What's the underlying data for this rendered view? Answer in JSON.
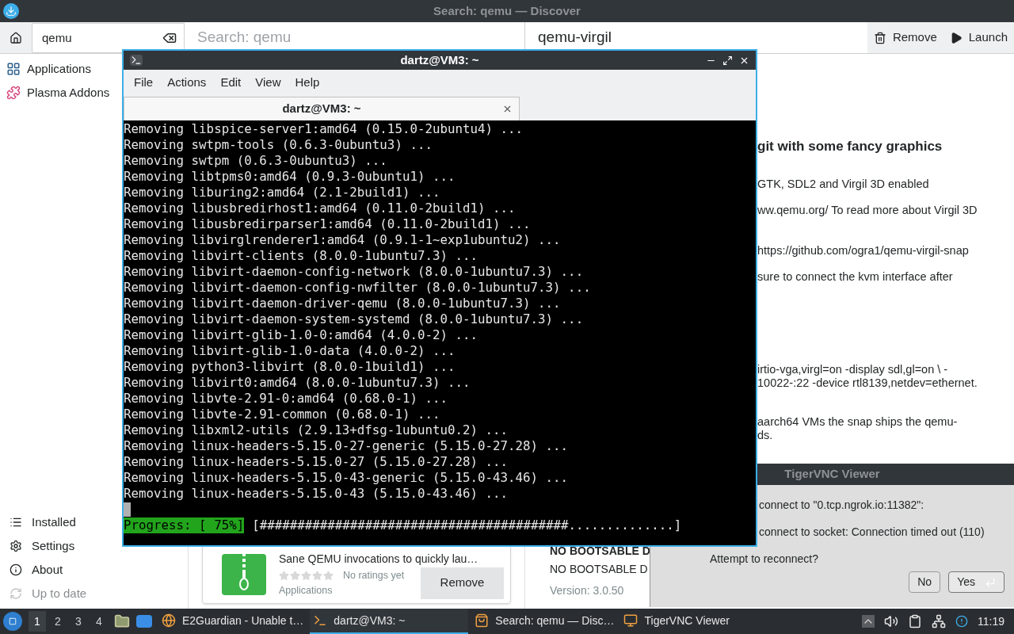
{
  "discover": {
    "title": "Search: qemu — Discover",
    "search": {
      "value": "qemu"
    },
    "list_header": "Search: qemu",
    "app_title": "qemu-virgil",
    "actions": [
      {
        "label": "Remove",
        "kind": "remove"
      },
      {
        "label": "Launch",
        "kind": "launch"
      }
    ],
    "categories": [
      {
        "label": "Applications",
        "kind": "applications"
      },
      {
        "label": "Plasma Addons",
        "kind": "addons"
      }
    ],
    "nav": [
      {
        "label": "Installed",
        "kind": "installed",
        "disabled": false
      },
      {
        "label": "Settings",
        "kind": "settings",
        "disabled": false
      },
      {
        "label": "About",
        "kind": "about",
        "disabled": false
      },
      {
        "label": "Up to date",
        "kind": "update",
        "disabled": true
      }
    ],
    "result_card": {
      "description": "Sane QEMU invocations to quickly lau…",
      "stars": 0,
      "rating_text": "No ratings yet",
      "category": "Applications",
      "button": "Remove"
    },
    "details": {
      "heading": "git with some fancy graphics",
      "paragraphs": [
        [
          "GTK, SDL2 and Virgil 3D enabled"
        ],
        [
          "ww.qemu.org/ To read more about Virgil 3D"
        ],
        [
          "https://github.com/ogra1/qemu-virgil-snap"
        ],
        [
          "sure to connect the kvm interface after"
        ],
        [
          "irtio-vga,virgl=on -display sdl,gl=on \\ -",
          "10022-:22 -device rtl8139,netdev=ethernet."
        ],
        [
          "aarch64 VMs the snap ships the qemu-",
          "ds."
        ]
      ]
    },
    "other_result": {
      "title": "NO BOOTSABLE D",
      "subtitle": "NO BOOTSABLE D",
      "version": "Version: 3.0.50"
    }
  },
  "terminal": {
    "title": "dartz@VM3: ~",
    "menu": [
      "File",
      "Actions",
      "Edit",
      "View",
      "Help"
    ],
    "tab": "dartz@VM3: ~",
    "lines": [
      "Removing libspice-server1:amd64 (0.15.0-2ubuntu4) ...",
      "Removing swtpm-tools (0.6.3-0ubuntu3) ...",
      "Removing swtpm (0.6.3-0ubuntu3) ...",
      "Removing libtpms0:amd64 (0.9.3-0ubuntu1) ...",
      "Removing liburing2:amd64 (2.1-2build1) ...",
      "Removing libusbredirhost1:amd64 (0.11.0-2build1) ...",
      "Removing libusbredirparser1:amd64 (0.11.0-2build1) ...",
      "Removing libvirglrenderer1:amd64 (0.9.1-1~exp1ubuntu2) ...",
      "Removing libvirt-clients (8.0.0-1ubuntu7.3) ...",
      "Removing libvirt-daemon-config-network (8.0.0-1ubuntu7.3) ...",
      "Removing libvirt-daemon-config-nwfilter (8.0.0-1ubuntu7.3) ...",
      "Removing libvirt-daemon-driver-qemu (8.0.0-1ubuntu7.3) ...",
      "Removing libvirt-daemon-system-systemd (8.0.0-1ubuntu7.3) ...",
      "Removing libvirt-glib-1.0-0:amd64 (4.0.0-2) ...",
      "Removing libvirt-glib-1.0-data (4.0.0-2) ...",
      "Removing python3-libvirt (8.0.0-1build1) ...",
      "Removing libvirt0:amd64 (8.0.0-1ubuntu7.3) ...",
      "Removing libvte-2.91-0:amd64 (0.68.0-1) ...",
      "Removing libvte-2.91-common (0.68.0-1) ...",
      "Removing libxml2-utils (2.9.13+dfsg-1ubuntu0.2) ...",
      "Removing linux-headers-5.15.0-27-generic (5.15.0-27.28) ...",
      "Removing linux-headers-5.15.0-27 (5.15.0-27.28) ...",
      "Removing linux-headers-5.15.0-43-generic (5.15.0-43.46) ...",
      "Removing linux-headers-5.15.0-43 (5.15.0-43.46) ..."
    ],
    "progress": {
      "label": "Progress: [ 75%]",
      "bar": "[#########################################..............]"
    }
  },
  "vnc_dialog": {
    "title": "TigerVNC Viewer",
    "lines": [
      "connect to \"0.tcp.ngrok.io:11382\":",
      "connect to socket: Connection timed out (110)"
    ],
    "question": "Attempt to reconnect?",
    "buttons": [
      {
        "label": "No",
        "default": false
      },
      {
        "label": "Yes",
        "default": true
      }
    ]
  },
  "taskbar": {
    "desktops": [
      {
        "label": "1",
        "selected": true
      },
      {
        "label": "2",
        "selected": false
      },
      {
        "label": "3",
        "selected": false
      },
      {
        "label": "4",
        "selected": false
      }
    ],
    "tasks": [
      {
        "label": "E2Guardian - Unable t…",
        "kind": "browser",
        "selected": false
      },
      {
        "label": "dartz@VM3: ~",
        "kind": "terminal",
        "selected": true
      },
      {
        "label": "Search: qemu — Disc…",
        "kind": "store",
        "selected": false
      },
      {
        "label": "TigerVNC Viewer",
        "kind": "vnc",
        "selected": false
      }
    ],
    "clock": "11:19"
  }
}
